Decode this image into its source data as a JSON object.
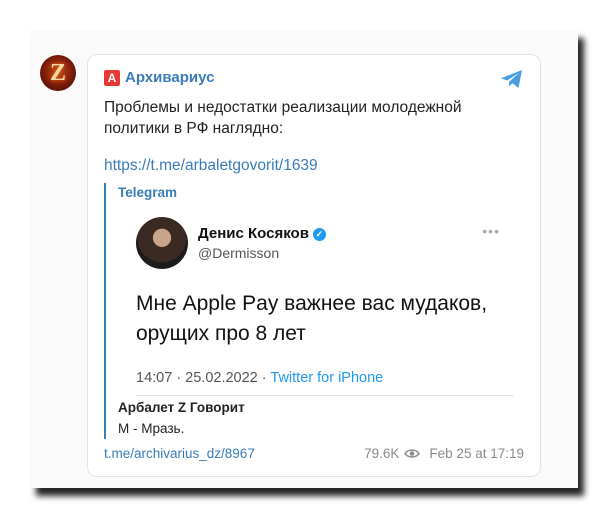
{
  "avatar_letter": "Z",
  "channel": {
    "badge": "А",
    "name": "Архивариус"
  },
  "post": {
    "text": "Проблемы и недостатки реализации молодежной политики в РФ наглядно:",
    "link": "https://t.me/arbaletgovorit/1639"
  },
  "forward": {
    "source": "Telegram",
    "tweet": {
      "name": "Денис Косяков",
      "handle": "@Dermisson",
      "more": "•••",
      "body": "Мне Apple Pay важнее вас мудаков, орущих про 8 лет",
      "timestamp": "14:07 · 25.02.2022 ·",
      "via": "Twitter for iPhone"
    },
    "caption_author": "Арбалет Z Говорит",
    "caption_text": "М - Мразь."
  },
  "footer": {
    "link": "t.me/archivarius_dz/8967",
    "views": "79.6K",
    "date": "Feb 25 at 17:19"
  },
  "colors": {
    "link": "#3a7cb8",
    "badge": "#e53935",
    "twitter_blue": "#1d9bf0"
  },
  "icons": [
    "telegram-icon",
    "verified-icon",
    "eye-icon"
  ]
}
